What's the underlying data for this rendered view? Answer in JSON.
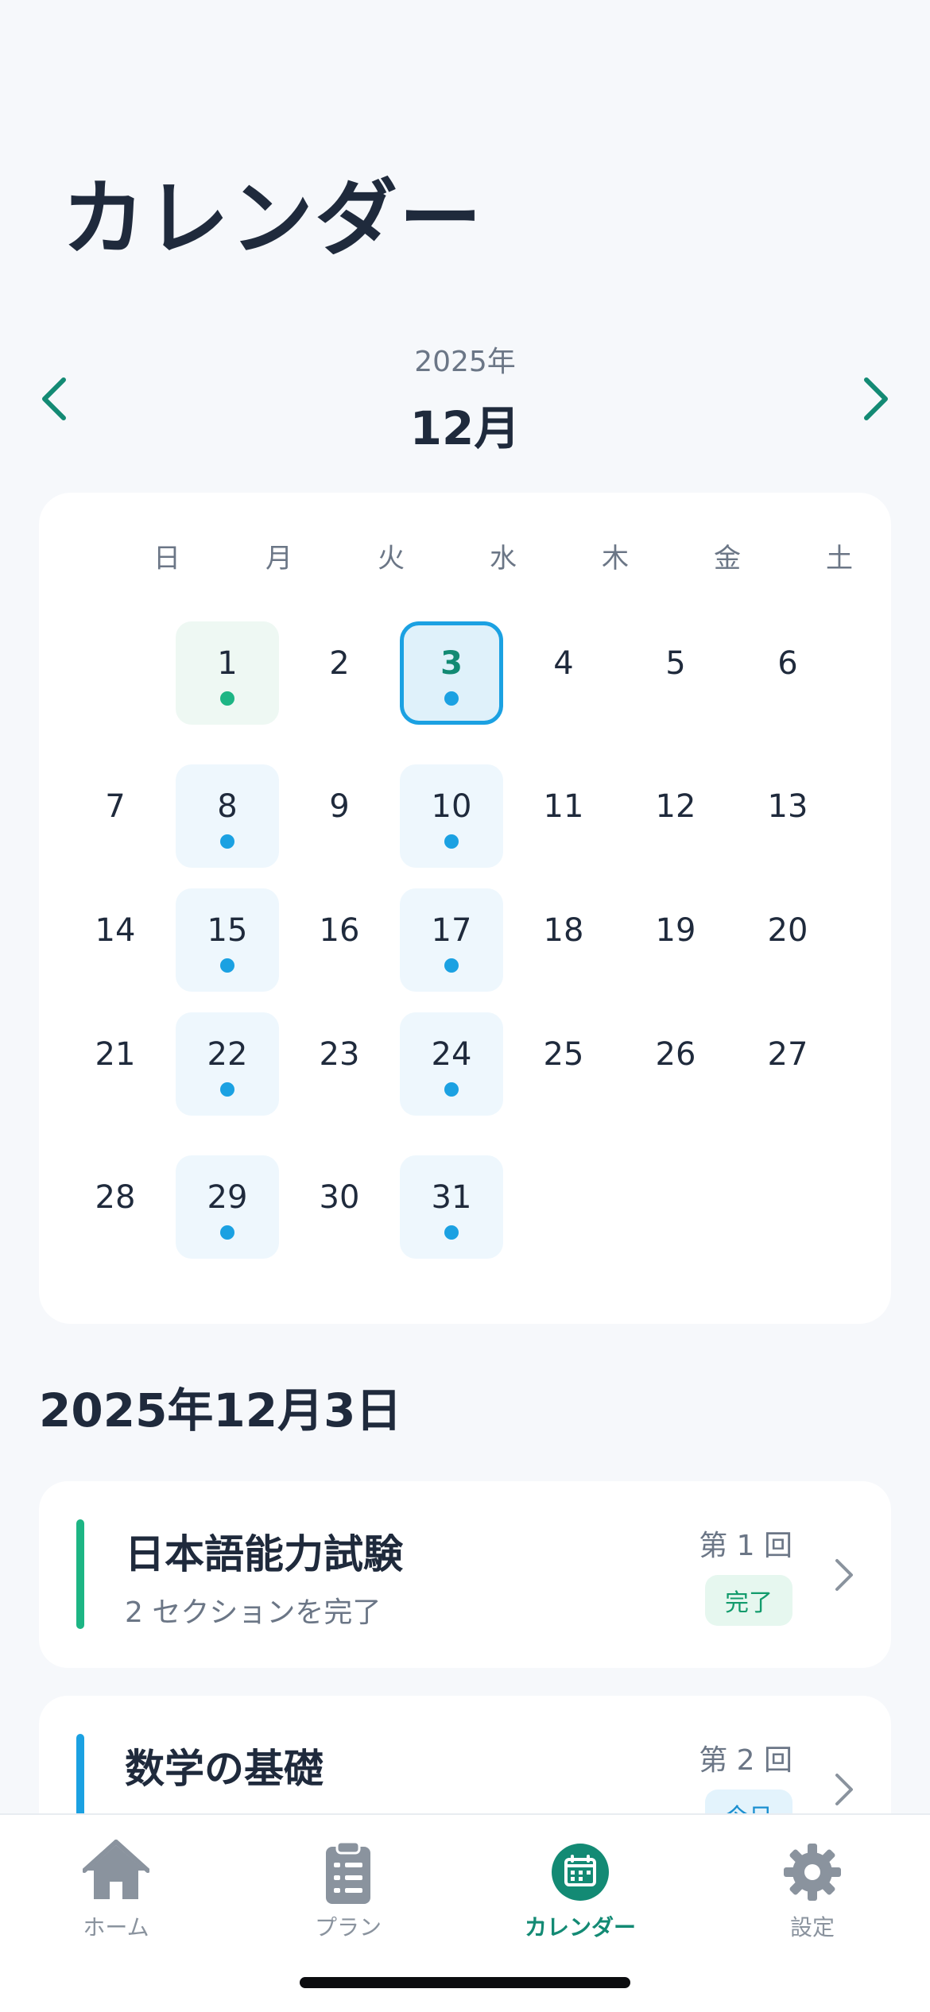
{
  "header": {
    "title": "カレンダー"
  },
  "month_nav": {
    "year": "2025年",
    "month": "12月"
  },
  "calendar": {
    "weekdays": [
      "日",
      "月",
      "火",
      "水",
      "木",
      "金",
      "土"
    ],
    "first_weekday": 1,
    "days_in_month": 31,
    "selected_day": 3,
    "completed_days": [
      1
    ],
    "planned_days": [
      3,
      8,
      10,
      15,
      17,
      22,
      24,
      29,
      31
    ]
  },
  "selected_date": {
    "heading": "2025年12月3日"
  },
  "sessions": [
    {
      "title": "日本語能力試験",
      "subtitle": "2 セクションを完了",
      "round": "第 1 回",
      "status": "完了",
      "accent": "#1db584"
    },
    {
      "title": "数学の基礎",
      "subtitle": "",
      "round": "第 2 回",
      "status": "今日",
      "accent": "#1ba1e2"
    }
  ],
  "tab_bar": {
    "tabs": [
      {
        "label": "ホーム",
        "icon": "home-icon"
      },
      {
        "label": "プラン",
        "icon": "clipboard-icon"
      },
      {
        "label": "カレンダー",
        "icon": "calendar-icon"
      },
      {
        "label": "設定",
        "icon": "gear-icon"
      }
    ],
    "active": 2
  },
  "colors": {
    "accent": "#138a74",
    "planned": "#1ba1e2",
    "completed": "#1db584"
  }
}
